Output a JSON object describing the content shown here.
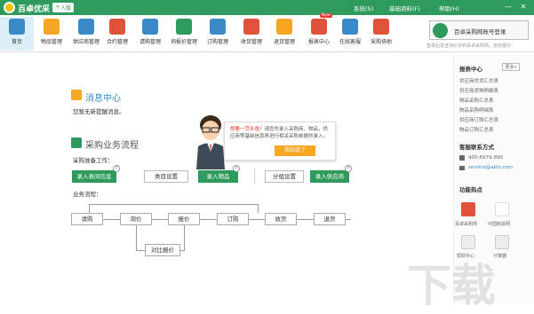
{
  "app": {
    "brand": "百卓优采",
    "edition": "个人版"
  },
  "menus": {
    "system": "系统(S)",
    "basic": "基础资料(F)",
    "help": "帮助(H)"
  },
  "window": {
    "minimize": "—",
    "close": "✕"
  },
  "toolbar": [
    {
      "label": "首页",
      "color": "#3a8ac7"
    },
    {
      "label": "物品管理",
      "color": "#f5a623"
    },
    {
      "label": "供应商管理",
      "color": "#3a8ac7"
    },
    {
      "label": "合约管理",
      "color": "#e0533a"
    },
    {
      "label": "请购管理",
      "color": "#3a8ac7"
    },
    {
      "label": "询报价管理",
      "color": "#2e9a5b"
    },
    {
      "label": "订购管理",
      "color": "#3a8ac7"
    },
    {
      "label": "收货管理",
      "color": "#e0533a"
    },
    {
      "label": "退货管理",
      "color": "#f5a623"
    },
    {
      "label": "报表中心",
      "color": "#e0533a"
    },
    {
      "label": "在线客服",
      "color": "#3a8ac7"
    },
    {
      "label": "采购协助",
      "color": "#e0533a"
    }
  ],
  "new_badge": "New",
  "login": {
    "button": "百卓采购网账号登录",
    "hint": "登录后发送询价单到百卓采购网，坐收报价!"
  },
  "message": {
    "title": "消息中心",
    "text": "您暂无新提醒消息。"
  },
  "process": {
    "title": "采购业务流程",
    "prep_label": "采购准备工作：",
    "flow_label": "业务流程：",
    "buttons": {
      "inquiry": "录入表间信息",
      "category": "类目设置",
      "item": "录入物品",
      "group": "分组设置",
      "supplier": "录入供应商"
    },
    "steps": {
      "request": "请购",
      "inquiry": "询价",
      "quote": "报价",
      "order": "订购",
      "receive": "收货",
      "return": "退货",
      "compare": "对比报价"
    }
  },
  "tip": {
    "highlight": "想要一劳永逸？",
    "text": "请您先录入采购商、物品，供应商等基础信息再进行相关采购单据的录入。",
    "button": "我知道了"
  },
  "help_mark": "?",
  "report_center": {
    "title": "报表中心",
    "more": "更多»",
    "links": [
      "供应商供货汇总表",
      "供应商货物明细表",
      "物品采购汇总表",
      "物品采购明细表",
      "供应商订购汇总表",
      "物品订购汇总表"
    ]
  },
  "service": {
    "title": "客服联系方式",
    "phone": "400-6979-890",
    "email": "service@abiz.com"
  },
  "features": {
    "title": "功能热点",
    "items": [
      "百卓采购网",
      "中国制造网",
      "帮助中心",
      "计算器"
    ]
  },
  "watermark": "下载"
}
